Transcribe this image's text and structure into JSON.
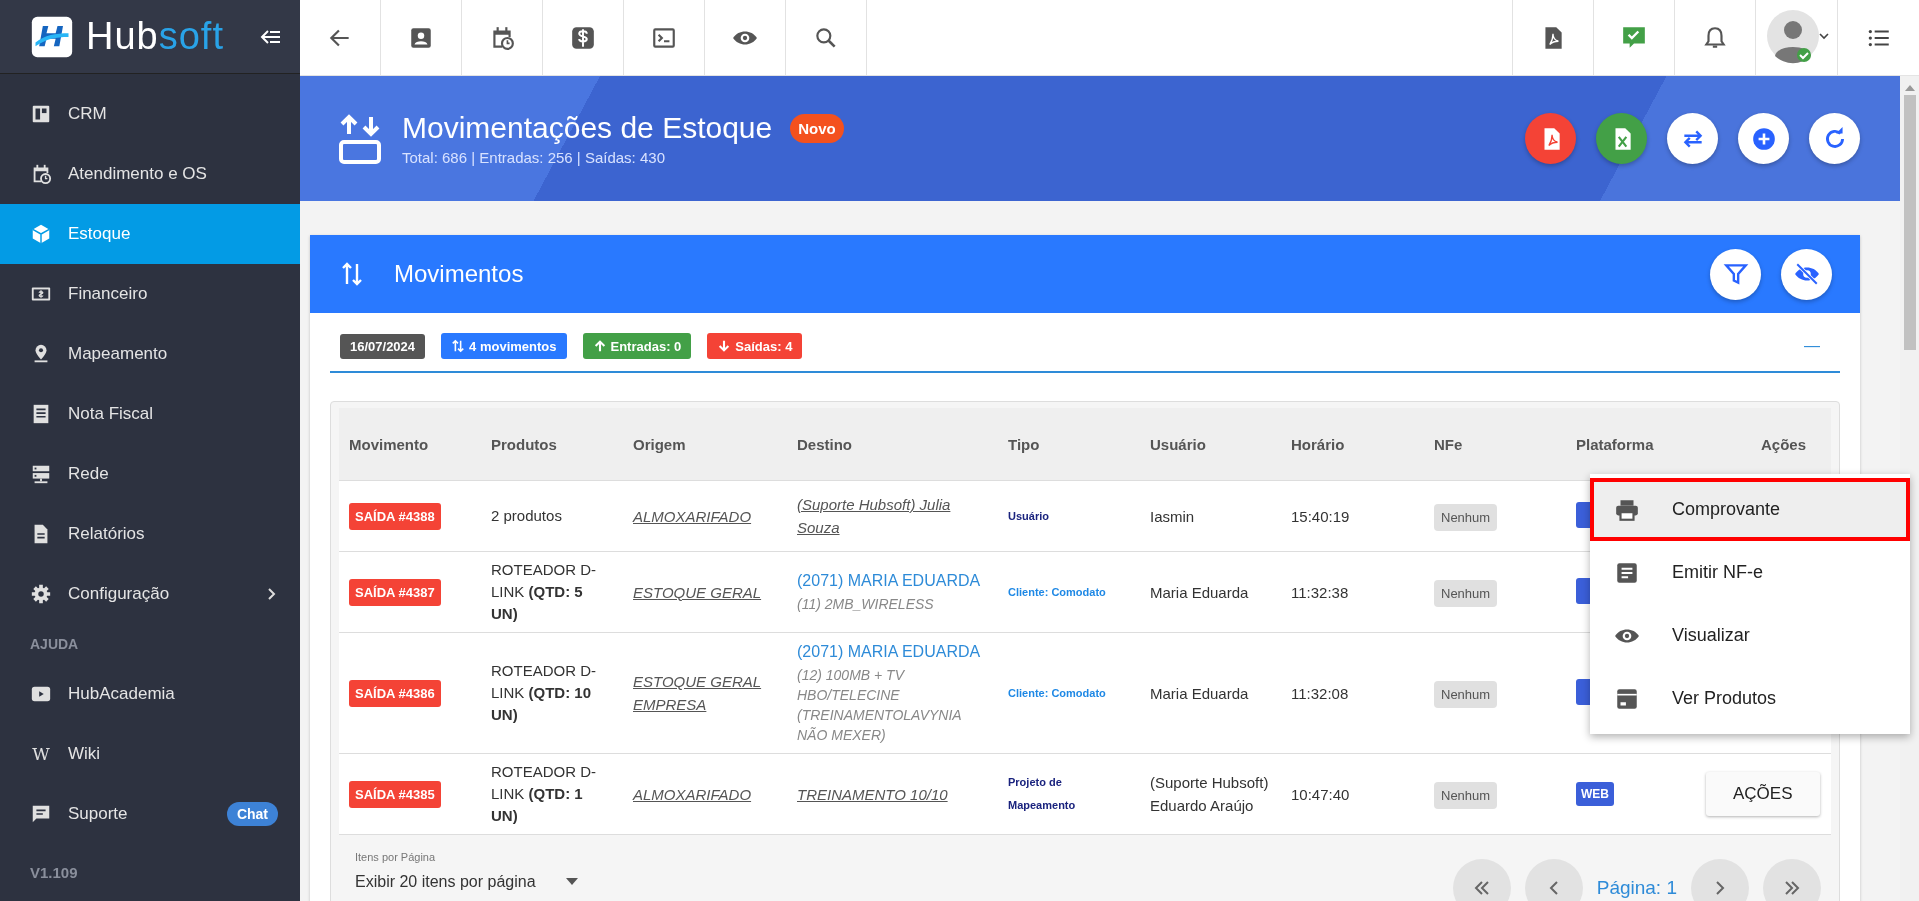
{
  "sidebar": {
    "logo": {
      "first": "Hub",
      "second": "soft"
    },
    "items": [
      {
        "kind": "item",
        "label": "CRM",
        "selected": false
      },
      {
        "kind": "item",
        "label": "Atendimento e OS",
        "selected": false
      },
      {
        "kind": "item",
        "label": "Estoque",
        "selected": true
      },
      {
        "kind": "item",
        "label": "Financeiro",
        "selected": false
      },
      {
        "kind": "item",
        "label": "Mapeamento",
        "selected": false
      },
      {
        "kind": "item",
        "label": "Nota Fiscal",
        "selected": false
      },
      {
        "kind": "item",
        "label": "Rede",
        "selected": false
      },
      {
        "kind": "item",
        "label": "Relatórios",
        "selected": false
      },
      {
        "kind": "item",
        "label": "Configuração",
        "selected": false,
        "submenu": true
      },
      {
        "kind": "heading",
        "label": "AJUDA"
      },
      {
        "kind": "item",
        "label": "HubAcademia",
        "selected": false
      },
      {
        "kind": "item",
        "label": "Wiki",
        "selected": false,
        "glyph": "W"
      },
      {
        "kind": "item",
        "label": "Suporte",
        "selected": false,
        "badge": "Chat"
      }
    ],
    "version": "V1.109"
  },
  "header": {
    "title": "Movimentações de Estoque",
    "badge": "Novo",
    "subtitle": "Total: 686 | Entradas: 256 | Saídas: 430"
  },
  "card": {
    "title": "Movimentos",
    "collapse": "—",
    "chips": [
      {
        "label": "16/07/2024",
        "color": "#555555"
      },
      {
        "label": "4 movimentos",
        "color": "#2979ff"
      },
      {
        "label": "Entradas: 0",
        "color": "#43a047"
      },
      {
        "label": "Saídas: 4",
        "color": "#f44336"
      }
    ]
  },
  "table": {
    "columns": [
      "Movimento",
      "Produtos",
      "Origem",
      "Destino",
      "Tipo",
      "Usuário",
      "Horário",
      "NFe",
      "Plataforma",
      "Ações"
    ],
    "rows": [
      {
        "movement": "SAÍDA #4388",
        "products": "2 produtos",
        "origin": "ALMOXARIFADO",
        "destination": {
          "kind": "link",
          "text": "(Suporte Hubsoft) Julia Souza"
        },
        "type": {
          "text": "Usuário",
          "color": "#1a237e"
        },
        "user": "Iasmin",
        "time": "15:40:19",
        "nfe": "Nenhum",
        "platform_covered": true
      },
      {
        "movement": "SAÍDA #4387",
        "products": "ROTEADOR D-LINK **(QTD: 5 UN)**",
        "origin": "ESTOQUE GERAL",
        "destination": {
          "kind": "client",
          "text": "(2071) MARIA EDUARDA",
          "detail": "(11) 2MB_WIRELESS"
        },
        "type": {
          "text": "Cliente: Comodato",
          "color": "#1e88e5"
        },
        "user": "Maria Eduarda",
        "time": "11:32:38",
        "nfe": "Nenhum",
        "platform_covered": true
      },
      {
        "movement": "SAÍDA #4386",
        "products": "ROTEADOR D-LINK **(QTD: 10 UN)**",
        "origin": "ESTOQUE GERAL EMPRESA",
        "destination": {
          "kind": "client",
          "text": "(2071) MARIA EDUARDA",
          "detail": "(12) 100MB + TV HBO/TELECINE (TREINAMENTOLAVYNIA NÃO MEXER)"
        },
        "type": {
          "text": "Cliente: Comodato",
          "color": "#1e88e5"
        },
        "user": "Maria Eduarda",
        "time": "11:32:08",
        "nfe": "Nenhum",
        "platform_covered": true
      },
      {
        "movement": "SAÍDA #4385",
        "products": "ROTEADOR D-LINK **(QTD: 1 UN)**",
        "origin": "ALMOXARIFADO",
        "destination": {
          "kind": "link",
          "text": "TREINAMENTO 10/10"
        },
        "type": {
          "text": "Projeto de Mapeamento",
          "color": "#1a237e"
        },
        "user": "(Suporte Hubsoft) Eduardo Araújo",
        "time": "10:47:40",
        "nfe": "Nenhum",
        "platform": "WEB",
        "actions": "AÇÕES"
      }
    ]
  },
  "menu": {
    "items": [
      {
        "label": "Comprovante",
        "selected": true
      },
      {
        "label": "Emitir NF-e",
        "selected": false
      },
      {
        "label": "Visualizar",
        "selected": false
      },
      {
        "label": "Ver Produtos",
        "selected": false
      }
    ]
  },
  "pagination": {
    "per_page_label": "Itens por Página",
    "per_page": "Exibir 20 itens por página",
    "page": "Página: 1"
  }
}
